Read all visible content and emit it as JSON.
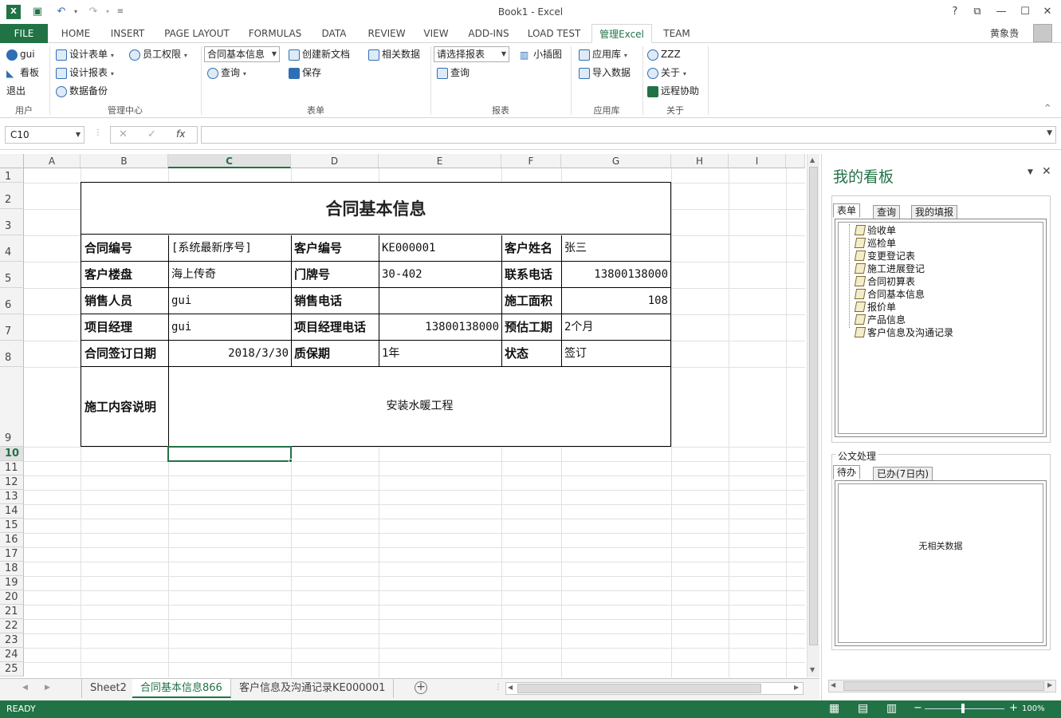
{
  "window": {
    "title": "Book1 - Excel",
    "user": "黄象贵",
    "help": "?"
  },
  "tabs": [
    "FILE",
    "HOME",
    "INSERT",
    "PAGE LAYOUT",
    "FORMULAS",
    "DATA",
    "REVIEW",
    "VIEW",
    "ADD-INS",
    "LOAD TEST",
    "管理Excel",
    "TEAM"
  ],
  "ribbon": {
    "user": {
      "items": [
        "gui",
        "看板",
        "退出"
      ],
      "label": "用户"
    },
    "manage": {
      "items": [
        "设计表单",
        "员工权限",
        "设计报表",
        "数据备份"
      ],
      "label": "管理中心"
    },
    "form": {
      "select": "合同基本信息",
      "items": [
        "查询",
        "创建新文档",
        "保存",
        "相关数据"
      ],
      "label": "表单"
    },
    "report": {
      "select": "请选择报表",
      "items": [
        "查询",
        "小插图"
      ],
      "label": "报表"
    },
    "app": {
      "items": [
        "应用库",
        "导入数据"
      ],
      "label": "应用库"
    },
    "about": {
      "items": [
        "ZZZ",
        "关于",
        "远程协助"
      ],
      "label": "关于"
    }
  },
  "formula_bar": {
    "name_box": "C10",
    "fx": "fx",
    "value": ""
  },
  "grid": {
    "columns": [
      "A",
      "B",
      "C",
      "D",
      "E",
      "F",
      "G",
      "H",
      "I"
    ],
    "rows": [
      "1",
      "2",
      "3",
      "4",
      "5",
      "6",
      "7",
      "8",
      "9",
      "10",
      "11",
      "12",
      "13",
      "14",
      "15",
      "16",
      "17",
      "18",
      "19",
      "20",
      "21",
      "22",
      "23",
      "24",
      "25"
    ],
    "selected_cell": "C10"
  },
  "form": {
    "title": "合同基本信息",
    "row4": [
      "合同编号",
      "[系统最新序号]",
      "客户编号",
      "KE000001",
      "客户姓名",
      "张三"
    ],
    "row5": [
      "客户楼盘",
      "海上传奇",
      "门牌号",
      "30-402",
      "联系电话",
      "13800138000"
    ],
    "row6": [
      "销售人员",
      "gui",
      "销售电话",
      "",
      "施工面积",
      "108"
    ],
    "row7": [
      "项目经理",
      "gui",
      "项目经理电话",
      "13800138000",
      "预估工期",
      "2个月"
    ],
    "row8": [
      "合同签订日期",
      "2018/3/30",
      "质保期",
      "1年",
      "状态",
      "签订"
    ],
    "desc_label": "施工内容说明",
    "desc_value": "安装水暖工程"
  },
  "sheet_tabs": [
    "Sheet2",
    "合同基本信息866",
    "客户信息及沟通记录KE000001"
  ],
  "status": {
    "text": "READY",
    "zoom": "100%"
  },
  "panel": {
    "title": "我的看板",
    "tabs": [
      "表单",
      "查询",
      "我的填报"
    ],
    "tree": [
      "验收单",
      "巡检单",
      "变更登记表",
      "施工进展登记",
      "合同初算表",
      "合同基本信息",
      "报价单",
      "产品信息",
      "客户信息及沟通记录"
    ],
    "doc_group": "公文处理",
    "doc_tabs": [
      "待办",
      "已办(7日内)"
    ],
    "doc_empty": "无相关数据"
  },
  "colors": {
    "excel_green": "#217346",
    "ribbon_icon": "#2f6fb5"
  }
}
